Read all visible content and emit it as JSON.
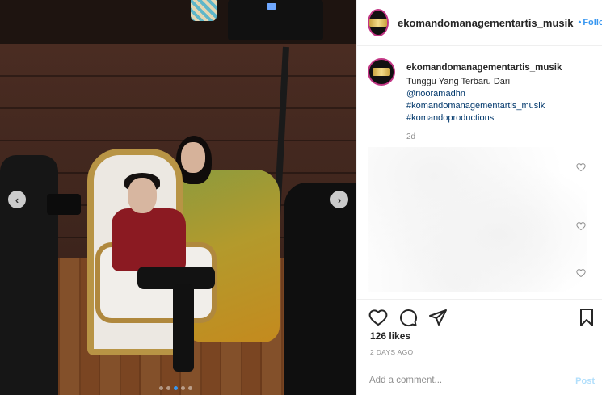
{
  "post": {
    "username": "ekomandomanagementartis_musik",
    "follow_dot": "•",
    "follow_label": "Follo",
    "caption_text": "Tunggu Yang Terbaru Dari",
    "caption_links": [
      "@riooramadhn",
      "#komandomanagementartis_musik",
      "#komandoproductions"
    ],
    "caption_time": "2d",
    "likes": "126 likes",
    "date": "2 DAYS AGO",
    "comment_placeholder": "Add a comment...",
    "post_label": "Post"
  },
  "carousel": {
    "prev_icon": "‹",
    "next_icon": "›",
    "slide_count": 5,
    "active_index": 2
  },
  "icons": {
    "like": "heart-icon",
    "comment": "comment-icon",
    "share": "share-icon",
    "save": "bookmark-icon",
    "comment_like": "heart-icon"
  },
  "colors": {
    "link": "#00376b",
    "accent": "#3897f0",
    "muted": "#8e8e8e"
  }
}
